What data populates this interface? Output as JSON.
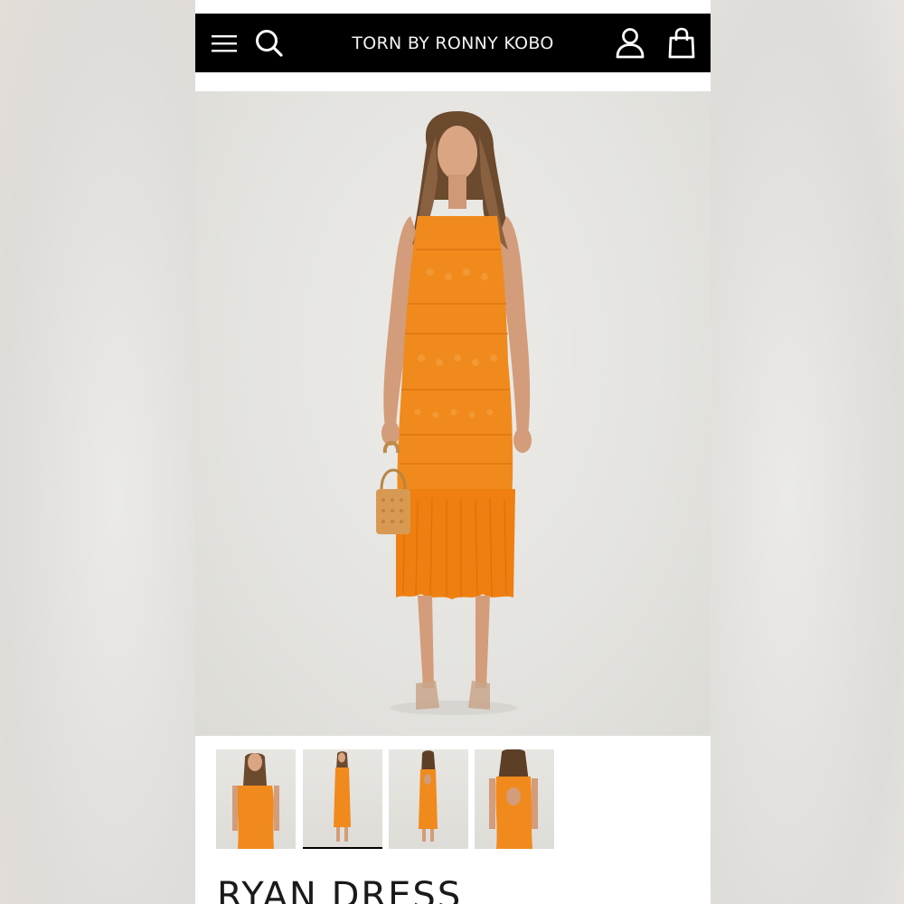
{
  "header": {
    "brand": "TORN BY RONNY KOBO",
    "icons": [
      "menu-icon",
      "search-icon",
      "account-icon",
      "shopping-bag-icon"
    ]
  },
  "colors": {
    "header_bg": "#000000",
    "dress": "#f08a1c",
    "background": "#e6e5e2"
  },
  "product": {
    "title": "RYAN DRESS",
    "thumbnails": [
      {
        "view": "front"
      },
      {
        "view": "front-full",
        "selected": true
      },
      {
        "view": "back-full"
      },
      {
        "view": "back"
      }
    ]
  }
}
